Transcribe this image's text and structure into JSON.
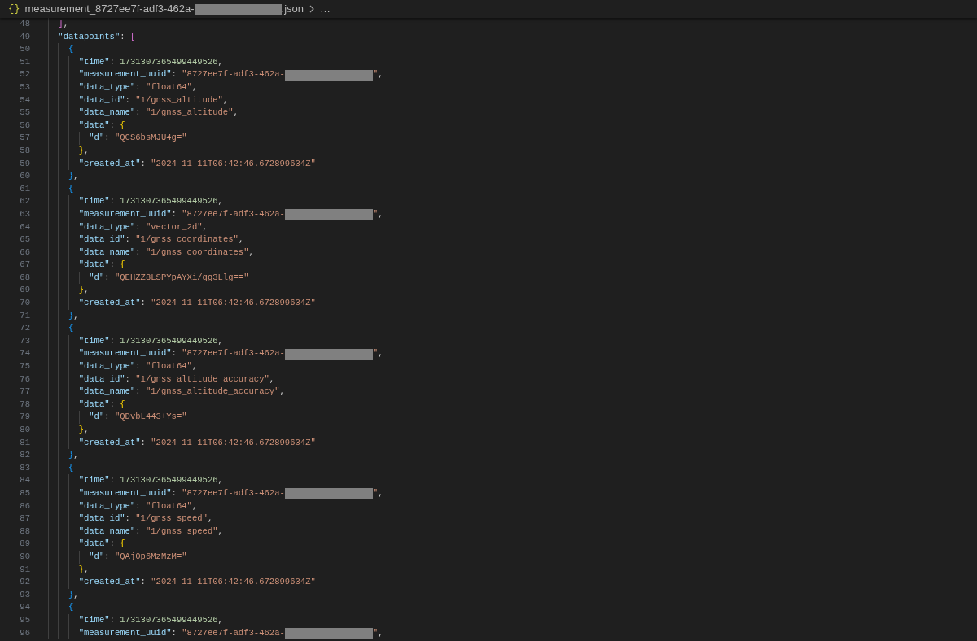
{
  "breadcrumb": {
    "icon": "{}",
    "name_parts": [
      {
        "kind": "text",
        "text": "measurement_8727ee7f-adf3-462a-"
      },
      {
        "kind": "redacted"
      },
      {
        "kind": "text",
        "text": ".json"
      }
    ],
    "more": "…"
  },
  "lines": [
    {
      "number": "48",
      "tokens": [
        {
          "kind": "b1",
          "text": "    ]"
        },
        {
          "kind": "p",
          "text": ","
        }
      ]
    },
    {
      "number": "49",
      "tokens": [
        {
          "kind": "key",
          "text": "    \"datapoints\""
        },
        {
          "kind": "p",
          "text": ": "
        },
        {
          "kind": "b1",
          "text": "["
        }
      ]
    },
    {
      "number": "50",
      "tokens": [
        {
          "kind": "b2",
          "text": "      {"
        }
      ]
    },
    {
      "number": "51",
      "tokens": [
        {
          "kind": "key",
          "text": "        \"time\""
        },
        {
          "kind": "p",
          "text": ": "
        },
        {
          "kind": "num",
          "text": "1731307365499449526"
        },
        {
          "kind": "p",
          "text": ","
        }
      ]
    },
    {
      "number": "52",
      "tokens": [
        {
          "kind": "key",
          "text": "        \"measurement_uuid\""
        },
        {
          "kind": "p",
          "text": ": "
        },
        {
          "kind": "str",
          "text": "\"8727ee7f-adf3-462a-"
        },
        {
          "kind": "redacted"
        },
        {
          "kind": "str",
          "text": "\""
        },
        {
          "kind": "p",
          "text": ","
        }
      ]
    },
    {
      "number": "53",
      "tokens": [
        {
          "kind": "key",
          "text": "        \"data_type\""
        },
        {
          "kind": "p",
          "text": ": "
        },
        {
          "kind": "str",
          "text": "\"float64\""
        },
        {
          "kind": "p",
          "text": ","
        }
      ]
    },
    {
      "number": "54",
      "tokens": [
        {
          "kind": "key",
          "text": "        \"data_id\""
        },
        {
          "kind": "p",
          "text": ": "
        },
        {
          "kind": "str",
          "text": "\"1/gnss_altitude\""
        },
        {
          "kind": "p",
          "text": ","
        }
      ]
    },
    {
      "number": "55",
      "tokens": [
        {
          "kind": "key",
          "text": "        \"data_name\""
        },
        {
          "kind": "p",
          "text": ": "
        },
        {
          "kind": "str",
          "text": "\"1/gnss_altitude\""
        },
        {
          "kind": "p",
          "text": ","
        }
      ]
    },
    {
      "number": "56",
      "tokens": [
        {
          "kind": "key",
          "text": "        \"data\""
        },
        {
          "kind": "p",
          "text": ": "
        },
        {
          "kind": "b3",
          "text": "{"
        }
      ]
    },
    {
      "number": "57",
      "tokens": [
        {
          "kind": "key",
          "text": "          \"d\""
        },
        {
          "kind": "p",
          "text": ": "
        },
        {
          "kind": "str",
          "text": "\"QCS6bsMJU4g=\""
        }
      ]
    },
    {
      "number": "58",
      "tokens": [
        {
          "kind": "b3",
          "text": "        }"
        },
        {
          "kind": "p",
          "text": ","
        }
      ]
    },
    {
      "number": "59",
      "tokens": [
        {
          "kind": "key",
          "text": "        \"created_at\""
        },
        {
          "kind": "p",
          "text": ": "
        },
        {
          "kind": "str",
          "text": "\"2024-11-11T06:42:46.672899634Z\""
        }
      ]
    },
    {
      "number": "60",
      "tokens": [
        {
          "kind": "b2",
          "text": "      }"
        },
        {
          "kind": "p",
          "text": ","
        }
      ]
    },
    {
      "number": "61",
      "tokens": [
        {
          "kind": "b2",
          "text": "      {"
        }
      ]
    },
    {
      "number": "62",
      "tokens": [
        {
          "kind": "key",
          "text": "        \"time\""
        },
        {
          "kind": "p",
          "text": ": "
        },
        {
          "kind": "num",
          "text": "1731307365499449526"
        },
        {
          "kind": "p",
          "text": ","
        }
      ]
    },
    {
      "number": "63",
      "tokens": [
        {
          "kind": "key",
          "text": "        \"measurement_uuid\""
        },
        {
          "kind": "p",
          "text": ": "
        },
        {
          "kind": "str",
          "text": "\"8727ee7f-adf3-462a-"
        },
        {
          "kind": "redacted"
        },
        {
          "kind": "str",
          "text": "\""
        },
        {
          "kind": "p",
          "text": ","
        }
      ]
    },
    {
      "number": "64",
      "tokens": [
        {
          "kind": "key",
          "text": "        \"data_type\""
        },
        {
          "kind": "p",
          "text": ": "
        },
        {
          "kind": "str",
          "text": "\"vector_2d\""
        },
        {
          "kind": "p",
          "text": ","
        }
      ]
    },
    {
      "number": "65",
      "tokens": [
        {
          "kind": "key",
          "text": "        \"data_id\""
        },
        {
          "kind": "p",
          "text": ": "
        },
        {
          "kind": "str",
          "text": "\"1/gnss_coordinates\""
        },
        {
          "kind": "p",
          "text": ","
        }
      ]
    },
    {
      "number": "66",
      "tokens": [
        {
          "kind": "key",
          "text": "        \"data_name\""
        },
        {
          "kind": "p",
          "text": ": "
        },
        {
          "kind": "str",
          "text": "\"1/gnss_coordinates\""
        },
        {
          "kind": "p",
          "text": ","
        }
      ]
    },
    {
      "number": "67",
      "tokens": [
        {
          "kind": "key",
          "text": "        \"data\""
        },
        {
          "kind": "p",
          "text": ": "
        },
        {
          "kind": "b3",
          "text": "{"
        }
      ]
    },
    {
      "number": "68",
      "tokens": [
        {
          "kind": "key",
          "text": "          \"d\""
        },
        {
          "kind": "p",
          "text": ": "
        },
        {
          "kind": "str",
          "text": "\"QEHZZ8LSPYpAYXi/qg3Llg==\""
        }
      ]
    },
    {
      "number": "69",
      "tokens": [
        {
          "kind": "b3",
          "text": "        }"
        },
        {
          "kind": "p",
          "text": ","
        }
      ]
    },
    {
      "number": "70",
      "tokens": [
        {
          "kind": "key",
          "text": "        \"created_at\""
        },
        {
          "kind": "p",
          "text": ": "
        },
        {
          "kind": "str",
          "text": "\"2024-11-11T06:42:46.672899634Z\""
        }
      ]
    },
    {
      "number": "71",
      "tokens": [
        {
          "kind": "b2",
          "text": "      }"
        },
        {
          "kind": "p",
          "text": ","
        }
      ]
    },
    {
      "number": "72",
      "tokens": [
        {
          "kind": "b2",
          "text": "      {"
        }
      ]
    },
    {
      "number": "73",
      "tokens": [
        {
          "kind": "key",
          "text": "        \"time\""
        },
        {
          "kind": "p",
          "text": ": "
        },
        {
          "kind": "num",
          "text": "1731307365499449526"
        },
        {
          "kind": "p",
          "text": ","
        }
      ]
    },
    {
      "number": "74",
      "tokens": [
        {
          "kind": "key",
          "text": "        \"measurement_uuid\""
        },
        {
          "kind": "p",
          "text": ": "
        },
        {
          "kind": "str",
          "text": "\"8727ee7f-adf3-462a-"
        },
        {
          "kind": "redacted"
        },
        {
          "kind": "str",
          "text": "\""
        },
        {
          "kind": "p",
          "text": ","
        }
      ]
    },
    {
      "number": "75",
      "tokens": [
        {
          "kind": "key",
          "text": "        \"data_type\""
        },
        {
          "kind": "p",
          "text": ": "
        },
        {
          "kind": "str",
          "text": "\"float64\""
        },
        {
          "kind": "p",
          "text": ","
        }
      ]
    },
    {
      "number": "76",
      "tokens": [
        {
          "kind": "key",
          "text": "        \"data_id\""
        },
        {
          "kind": "p",
          "text": ": "
        },
        {
          "kind": "str",
          "text": "\"1/gnss_altitude_accuracy\""
        },
        {
          "kind": "p",
          "text": ","
        }
      ]
    },
    {
      "number": "77",
      "tokens": [
        {
          "kind": "key",
          "text": "        \"data_name\""
        },
        {
          "kind": "p",
          "text": ": "
        },
        {
          "kind": "str",
          "text": "\"1/gnss_altitude_accuracy\""
        },
        {
          "kind": "p",
          "text": ","
        }
      ]
    },
    {
      "number": "78",
      "tokens": [
        {
          "kind": "key",
          "text": "        \"data\""
        },
        {
          "kind": "p",
          "text": ": "
        },
        {
          "kind": "b3",
          "text": "{"
        }
      ]
    },
    {
      "number": "79",
      "tokens": [
        {
          "kind": "key",
          "text": "          \"d\""
        },
        {
          "kind": "p",
          "text": ": "
        },
        {
          "kind": "str",
          "text": "\"QDvbL443+Ys=\""
        }
      ]
    },
    {
      "number": "80",
      "tokens": [
        {
          "kind": "b3",
          "text": "        }"
        },
        {
          "kind": "p",
          "text": ","
        }
      ]
    },
    {
      "number": "81",
      "tokens": [
        {
          "kind": "key",
          "text": "        \"created_at\""
        },
        {
          "kind": "p",
          "text": ": "
        },
        {
          "kind": "str",
          "text": "\"2024-11-11T06:42:46.672899634Z\""
        }
      ]
    },
    {
      "number": "82",
      "tokens": [
        {
          "kind": "b2",
          "text": "      }"
        },
        {
          "kind": "p",
          "text": ","
        }
      ]
    },
    {
      "number": "83",
      "tokens": [
        {
          "kind": "b2",
          "text": "      {"
        }
      ]
    },
    {
      "number": "84",
      "tokens": [
        {
          "kind": "key",
          "text": "        \"time\""
        },
        {
          "kind": "p",
          "text": ": "
        },
        {
          "kind": "num",
          "text": "1731307365499449526"
        },
        {
          "kind": "p",
          "text": ","
        }
      ]
    },
    {
      "number": "85",
      "tokens": [
        {
          "kind": "key",
          "text": "        \"measurement_uuid\""
        },
        {
          "kind": "p",
          "text": ": "
        },
        {
          "kind": "str",
          "text": "\"8727ee7f-adf3-462a-"
        },
        {
          "kind": "redacted"
        },
        {
          "kind": "str",
          "text": "\""
        },
        {
          "kind": "p",
          "text": ","
        }
      ]
    },
    {
      "number": "86",
      "tokens": [
        {
          "kind": "key",
          "text": "        \"data_type\""
        },
        {
          "kind": "p",
          "text": ": "
        },
        {
          "kind": "str",
          "text": "\"float64\""
        },
        {
          "kind": "p",
          "text": ","
        }
      ]
    },
    {
      "number": "87",
      "tokens": [
        {
          "kind": "key",
          "text": "        \"data_id\""
        },
        {
          "kind": "p",
          "text": ": "
        },
        {
          "kind": "str",
          "text": "\"1/gnss_speed\""
        },
        {
          "kind": "p",
          "text": ","
        }
      ]
    },
    {
      "number": "88",
      "tokens": [
        {
          "kind": "key",
          "text": "        \"data_name\""
        },
        {
          "kind": "p",
          "text": ": "
        },
        {
          "kind": "str",
          "text": "\"1/gnss_speed\""
        },
        {
          "kind": "p",
          "text": ","
        }
      ]
    },
    {
      "number": "89",
      "tokens": [
        {
          "kind": "key",
          "text": "        \"data\""
        },
        {
          "kind": "p",
          "text": ": "
        },
        {
          "kind": "b3",
          "text": "{"
        }
      ]
    },
    {
      "number": "90",
      "tokens": [
        {
          "kind": "key",
          "text": "          \"d\""
        },
        {
          "kind": "p",
          "text": ": "
        },
        {
          "kind": "str",
          "text": "\"QAj0p6MzMzM=\""
        }
      ]
    },
    {
      "number": "91",
      "tokens": [
        {
          "kind": "b3",
          "text": "        }"
        },
        {
          "kind": "p",
          "text": ","
        }
      ]
    },
    {
      "number": "92",
      "tokens": [
        {
          "kind": "key",
          "text": "        \"created_at\""
        },
        {
          "kind": "p",
          "text": ": "
        },
        {
          "kind": "str",
          "text": "\"2024-11-11T06:42:46.672899634Z\""
        }
      ]
    },
    {
      "number": "93",
      "tokens": [
        {
          "kind": "b2",
          "text": "      }"
        },
        {
          "kind": "p",
          "text": ","
        }
      ]
    },
    {
      "number": "94",
      "tokens": [
        {
          "kind": "b2",
          "text": "      {"
        }
      ]
    },
    {
      "number": "95",
      "tokens": [
        {
          "kind": "key",
          "text": "        \"time\""
        },
        {
          "kind": "p",
          "text": ": "
        },
        {
          "kind": "num",
          "text": "1731307365499449526"
        },
        {
          "kind": "p",
          "text": ","
        }
      ]
    },
    {
      "number": "96",
      "tokens": [
        {
          "kind": "key",
          "text": "        \"measurement_uuid\""
        },
        {
          "kind": "p",
          "text": ": "
        },
        {
          "kind": "str",
          "text": "\"8727ee7f-adf3-462a-"
        },
        {
          "kind": "redacted"
        },
        {
          "kind": "str",
          "text": "\""
        },
        {
          "kind": "p",
          "text": ","
        }
      ]
    }
  ]
}
